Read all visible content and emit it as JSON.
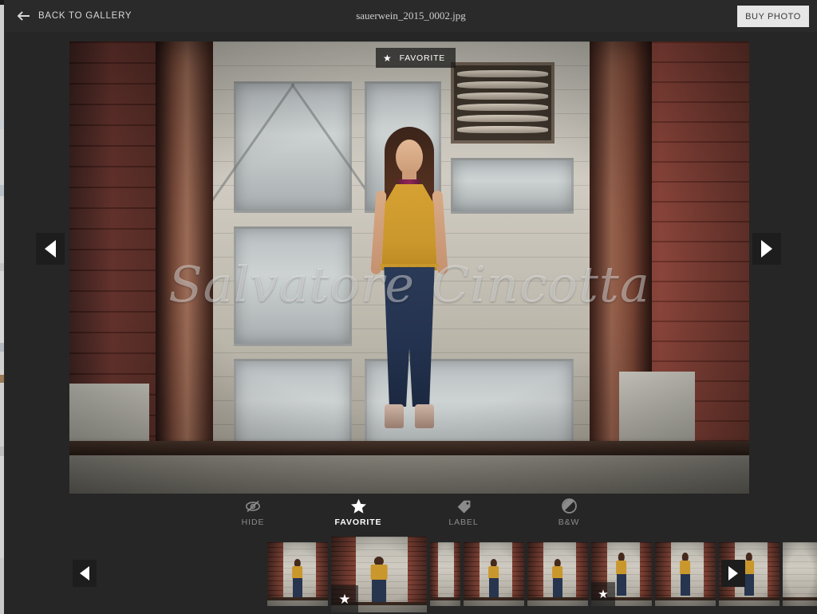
{
  "header": {
    "back_icon": "arrow-left-icon",
    "back_label": "BACK TO GALLERY",
    "title": "sauerwein_2015_0002.jpg",
    "buy_label": "BUY PHOTO"
  },
  "photo": {
    "watermark": "Salvatore Cincotta",
    "favorite_badge": {
      "icon": "star-icon",
      "label": "FAVORITE",
      "star_glyph": "★"
    },
    "prev_icon": "triangle-left-icon",
    "next_icon": "triangle-right-icon"
  },
  "toolbar": {
    "items": [
      {
        "name": "hide",
        "label": "HIDE",
        "icon": "eye-slash-icon",
        "active": false
      },
      {
        "name": "favorite",
        "label": "FAVORITE",
        "icon": "star-icon",
        "active": true
      },
      {
        "name": "label",
        "label": "LABEL",
        "icon": "tag-icon",
        "active": false
      },
      {
        "name": "bw",
        "label": "B&W",
        "icon": "half-circle-icon",
        "active": false
      }
    ]
  },
  "filmstrip": {
    "prev_icon": "triangle-left-icon",
    "next_icon": "triangle-right-icon",
    "star_glyph": "★",
    "thumbnails": [
      {
        "name": "thumb-1",
        "selected": false,
        "favorite": false,
        "clipped": false
      },
      {
        "name": "thumb-2",
        "selected": true,
        "favorite": true,
        "clipped": false
      },
      {
        "name": "thumb-3",
        "selected": false,
        "favorite": false,
        "clipped": true
      },
      {
        "name": "thumb-4",
        "selected": false,
        "favorite": false,
        "clipped": false
      },
      {
        "name": "thumb-5",
        "selected": false,
        "favorite": false,
        "clipped": false
      },
      {
        "name": "thumb-6",
        "selected": false,
        "favorite": true,
        "clipped": false
      },
      {
        "name": "thumb-7",
        "selected": false,
        "favorite": false,
        "clipped": false
      },
      {
        "name": "thumb-8",
        "selected": false,
        "favorite": false,
        "clipped": false
      },
      {
        "name": "thumb-9",
        "selected": false,
        "favorite": false,
        "clipped": true
      }
    ]
  },
  "colors": {
    "app_background": "#262626",
    "header_background": "#2a2a2a",
    "buy_button_background": "#e6e6e6",
    "buy_button_text": "#3a3a3a",
    "active_tool": "#ffffff",
    "inactive_tool": "#8b8b8b",
    "nav_button_background": "#1d1d1d"
  }
}
